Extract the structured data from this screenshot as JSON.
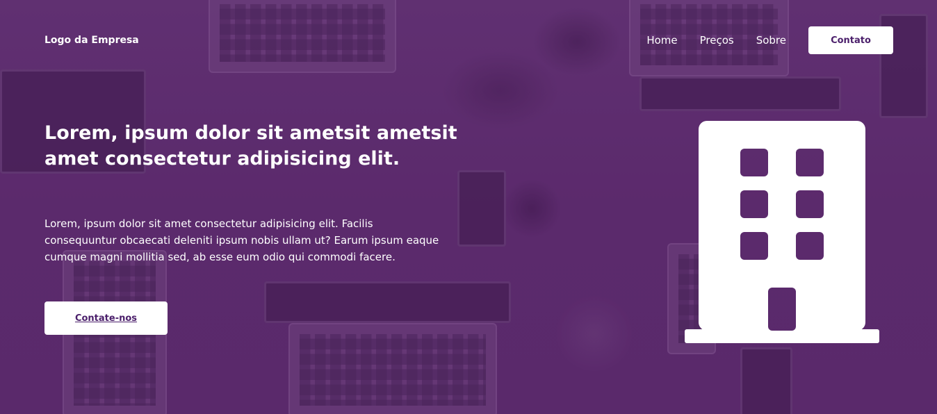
{
  "header": {
    "logo": "Logo da Empresa",
    "nav": [
      {
        "label": "Home"
      },
      {
        "label": "Preços"
      },
      {
        "label": "Sobre"
      }
    ],
    "contact_button": "Contato"
  },
  "hero": {
    "headline": "Lorem, ipsum dolor sit ametsit ametsit amet consectetur adipisicing elit.",
    "lead": "Lorem, ipsum dolor sit amet consectetur adipisicing elit. Facilis consequuntur obcaecati deleniti ipsum nobis ullam ut? Earum ipsum eaque cumque magni mollitia sed, ab esse eum odio qui commodi facere.",
    "cta_button": "Contate-nos",
    "illustration_icon": "building-icon"
  },
  "colors": {
    "overlay": "#5c2c6d",
    "button_bg": "#ffffff",
    "button_text": "#4b1f6b",
    "text": "#ffffff"
  }
}
